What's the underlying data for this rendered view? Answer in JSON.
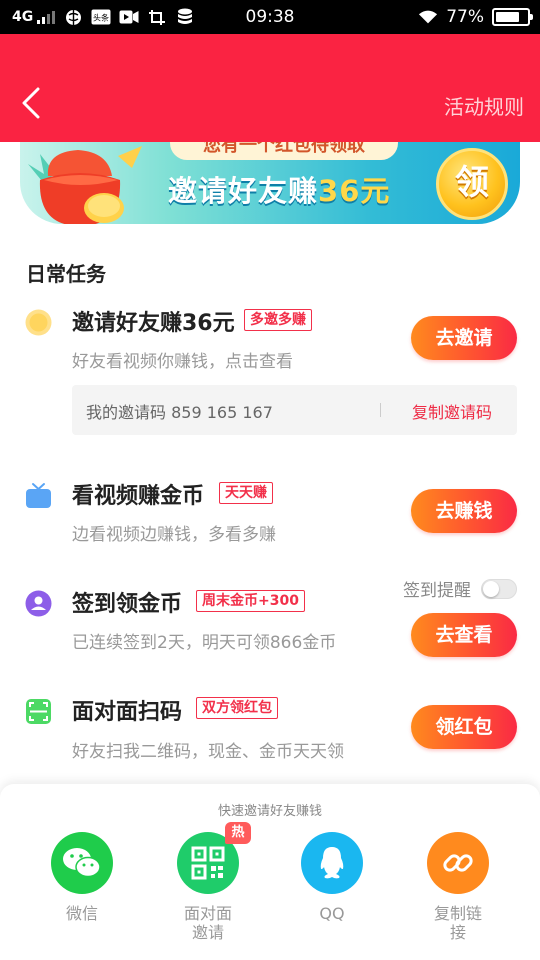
{
  "status_bar": {
    "network": "4G",
    "time": "09:38",
    "battery": "77%",
    "battery_level": 0.77
  },
  "header": {
    "rules_label": "活动规则"
  },
  "banner": {
    "top_text": "您有一个红包待领取",
    "title_prefix": "邀请好友赚",
    "title_amount": "36元",
    "coin_text": "领"
  },
  "section": {
    "title": "日常任务"
  },
  "tasks": [
    {
      "title": "邀请好友赚36元",
      "tag": "多邀多赚",
      "desc": "好友看视频你赚钱，点击查看",
      "button": "去邀请"
    },
    {
      "title": "看视频赚金币",
      "tag": "天天赚",
      "desc": "边看视频边赚钱，多看多赚",
      "button": "去赚钱"
    },
    {
      "title": "签到领金币",
      "tag": "周末金币+300",
      "desc": "已连续签到2天，明天可领866金币",
      "button": "去查看"
    },
    {
      "title": "面对面扫码",
      "tag": "双方领红包",
      "desc": "好友扫我二维码，现金、金币天天领",
      "button": "领红包"
    }
  ],
  "invite_code": {
    "label": "我的邀请码 859 165 167",
    "copy_label": "复制邀请码"
  },
  "sign_reminder": {
    "label": "签到提醒",
    "enabled": false
  },
  "share": {
    "title": "快速邀请好友赚钱",
    "hot_badge": "热",
    "items": [
      {
        "label": "微信",
        "icon": "wechat-icon",
        "color": "#1fcc4b"
      },
      {
        "label": "面对面\n邀请",
        "icon": "qrcode-icon",
        "color": "#1fcc6a"
      },
      {
        "label": "QQ",
        "icon": "qq-icon",
        "color": "#1ab7f0"
      },
      {
        "label": "复制链\n接",
        "icon": "link-icon",
        "color": "#ff8a1e"
      }
    ]
  },
  "colors": {
    "header_red": "#fa2342",
    "accent_red": "#f2304a",
    "button_gradient_start": "#ff8a1e",
    "button_gradient_end": "#fa2a44"
  }
}
